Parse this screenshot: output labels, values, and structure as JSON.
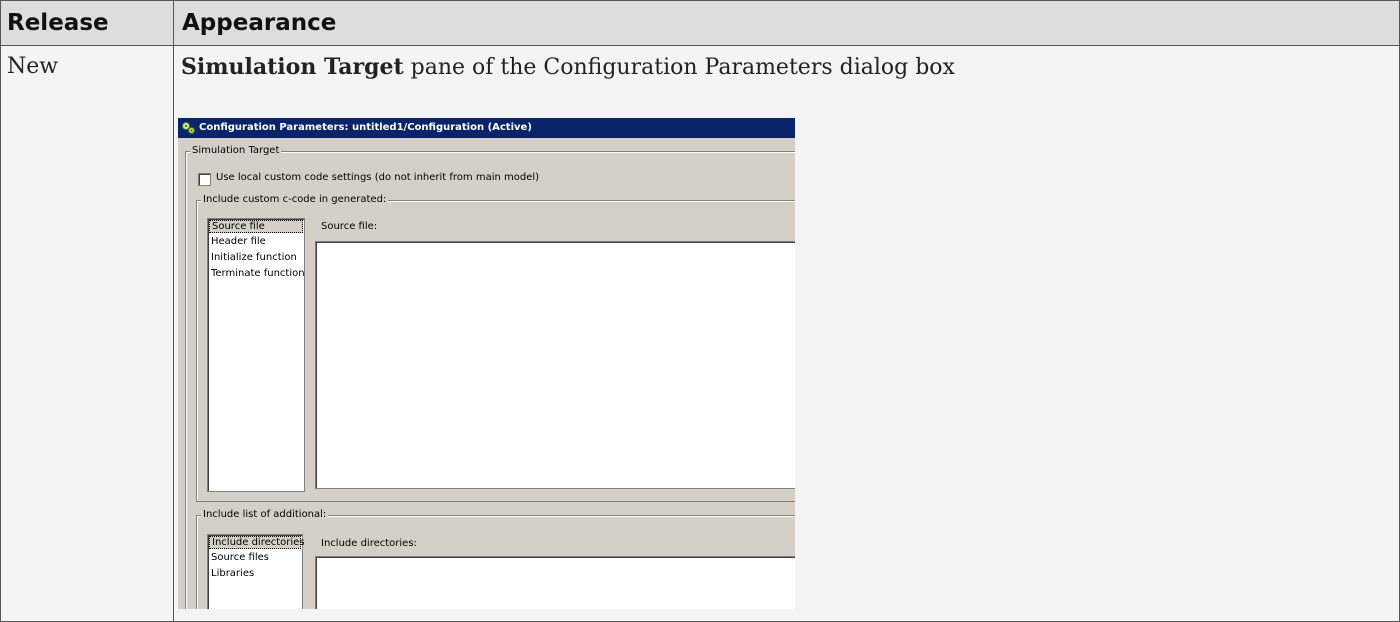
{
  "table": {
    "headers": {
      "release": "Release",
      "appearance": "Appearance"
    },
    "rows": [
      {
        "release": "New",
        "appearance_bold": "Simulation Target",
        "appearance_rest": " pane of the Configuration Parameters dialog box"
      }
    ]
  },
  "dialog": {
    "title": "Configuration Parameters: untitled1/Configuration (Active)",
    "title_icon": "simulink-gear-icon",
    "group_main": "Simulation Target",
    "checkbox_label": "Use local custom code settings (do not inherit from main model)",
    "checkbox_checked": false,
    "group_custom_code": "Include custom c-code in generated:",
    "custom_code_items": [
      "Source file",
      "Header file",
      "Initialize function",
      "Terminate function"
    ],
    "custom_code_selected": "Source file",
    "source_file_label": "Source file:",
    "group_additional": "Include list of additional:",
    "additional_items": [
      "Include directories",
      "Source files",
      "Libraries"
    ],
    "additional_selected": "Include directories",
    "include_dirs_label": "Include directories:"
  },
  "colors": {
    "header_bg": "#dddddd",
    "row_bg": "#f4f4f4",
    "titlebar": "#0a246a",
    "dialog_bg": "#d4d0c8"
  }
}
